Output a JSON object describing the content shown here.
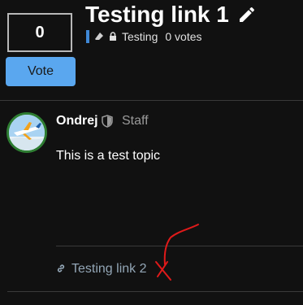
{
  "vote": {
    "count": "0",
    "button_label": "Vote"
  },
  "topic": {
    "title": "Testing link 1",
    "category": "Testing",
    "votes": "0 votes"
  },
  "post": {
    "username": "Ondrej",
    "role": "Staff",
    "body": "This is a test topic"
  },
  "related": {
    "link_text": "Testing link 2"
  },
  "colors": {
    "accent": "#5aa7ef",
    "category": "#3f88d6",
    "annotation": "#e01a1a"
  }
}
